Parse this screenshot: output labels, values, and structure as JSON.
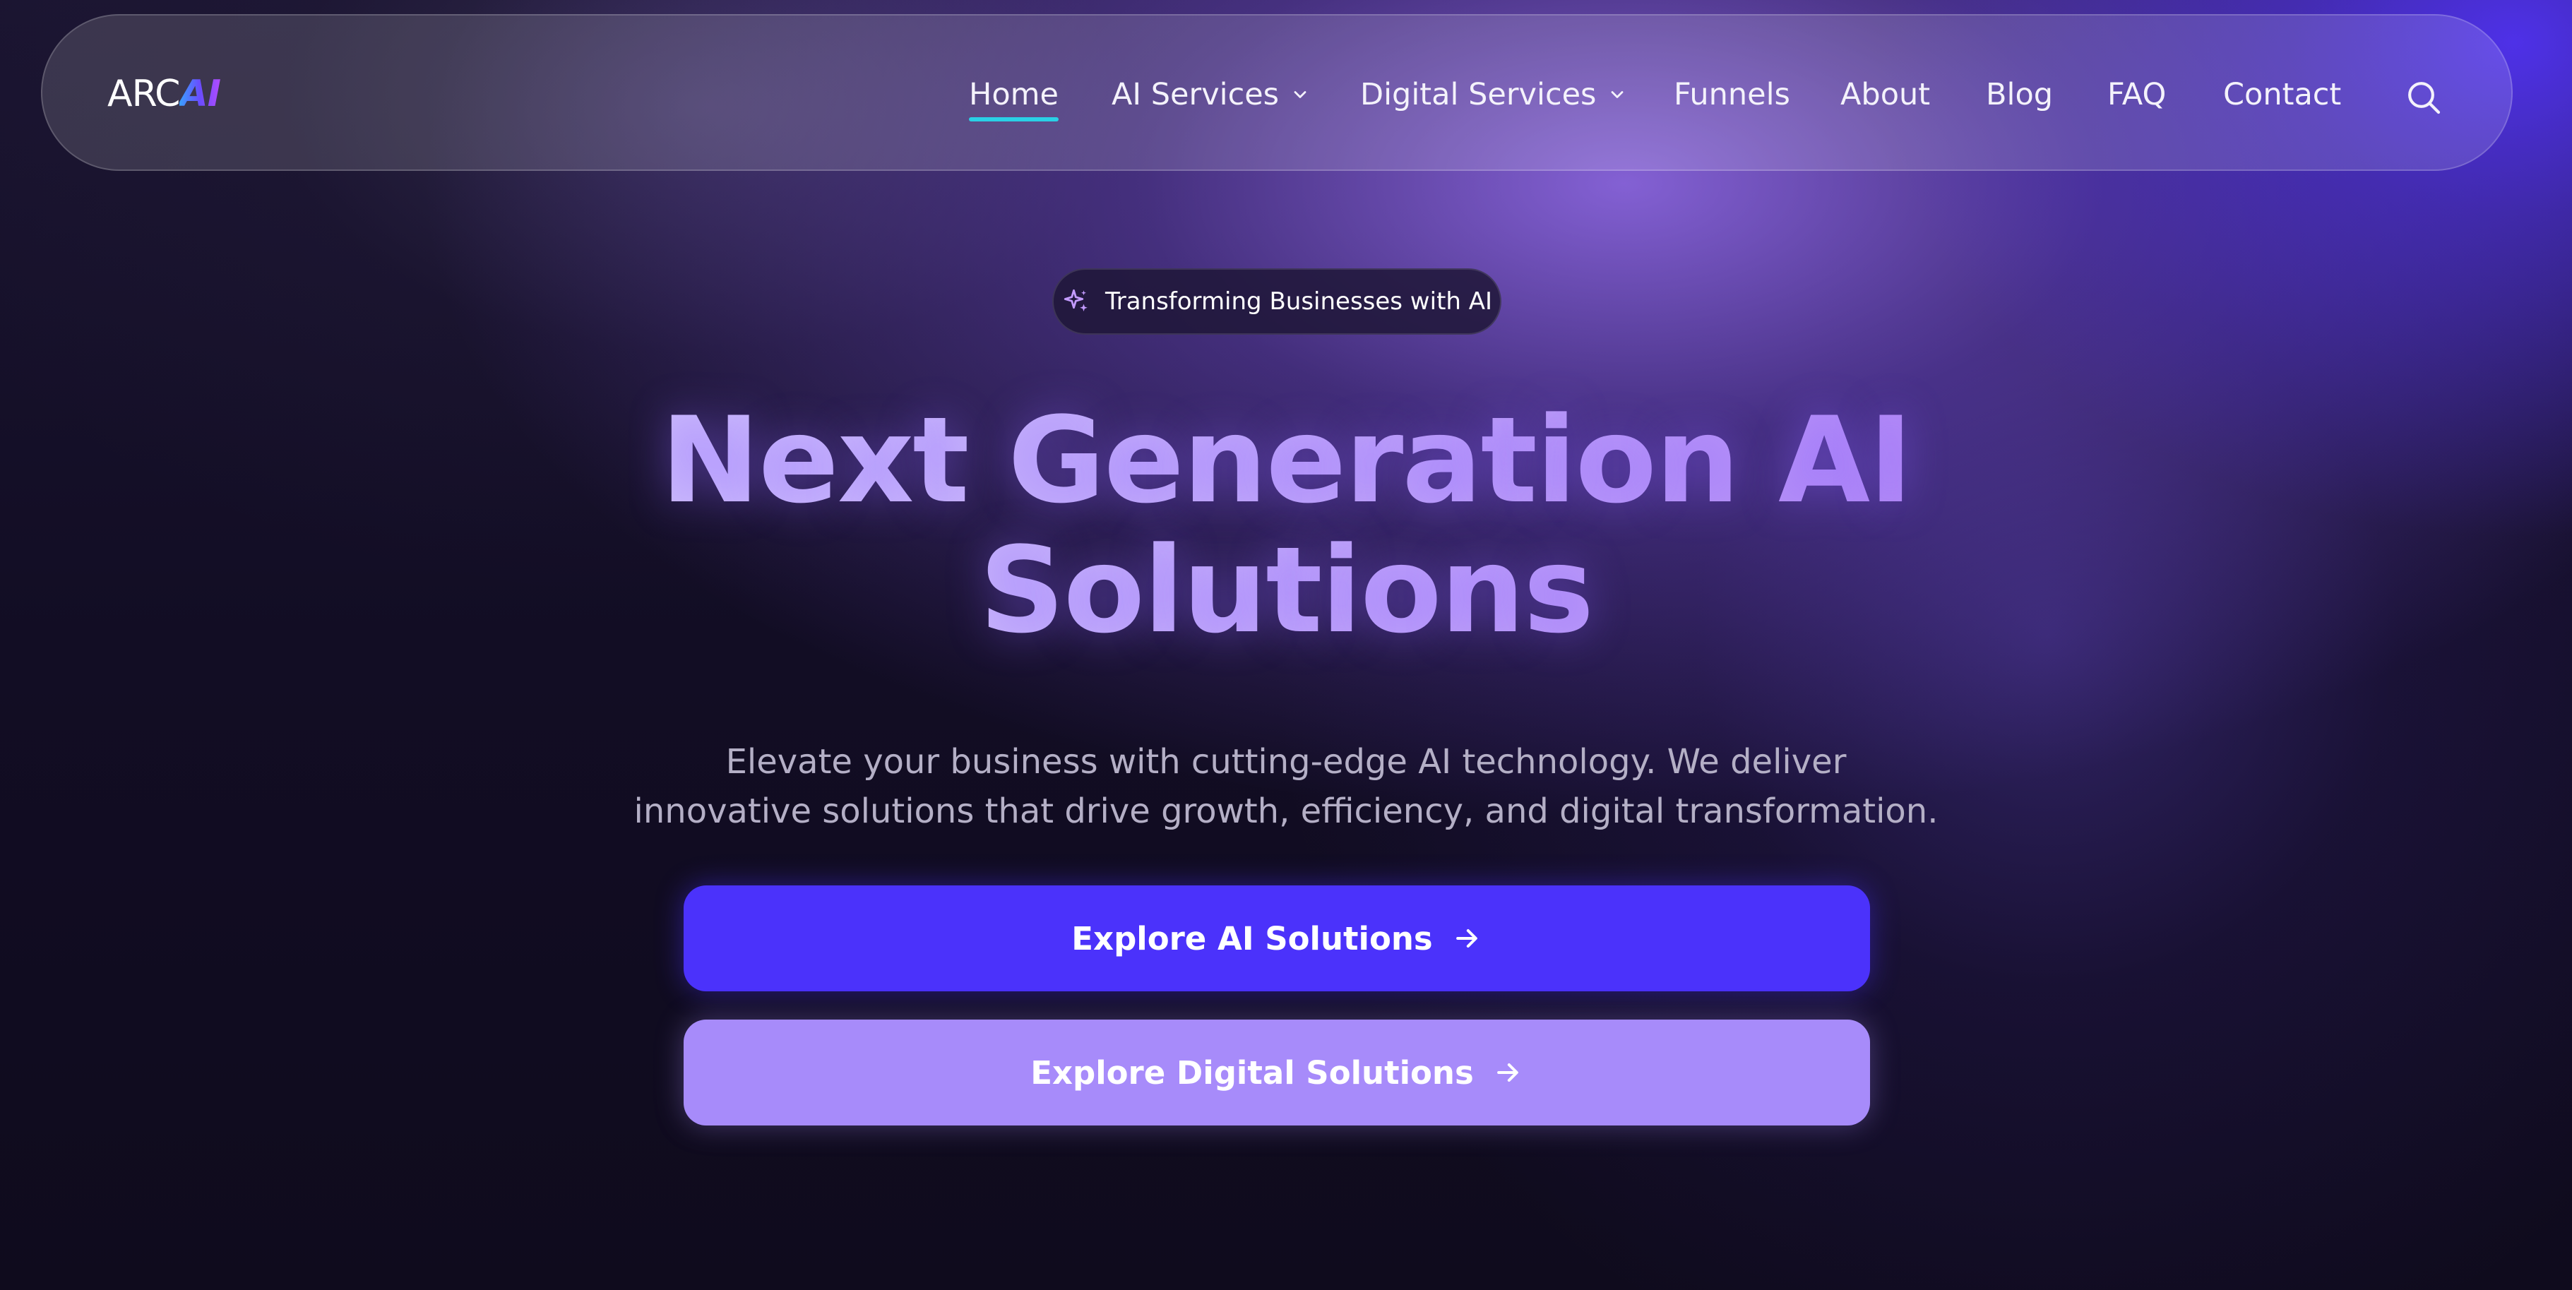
{
  "nav": {
    "logo_arc": "ARC",
    "logo_ai": "AI",
    "links": [
      {
        "label": "Home",
        "active": true
      },
      {
        "label": "AI Services",
        "dropdown": true
      },
      {
        "label": "Digital Services",
        "dropdown": true
      },
      {
        "label": "Funnels"
      },
      {
        "label": "About"
      },
      {
        "label": "Blog"
      },
      {
        "label": "FAQ"
      },
      {
        "label": "Contact"
      }
    ],
    "search_icon": "search-icon"
  },
  "hero": {
    "badge": "Transforming Businesses with AI",
    "badge_icon": "sparkle-icon",
    "title_line1": "Next Generation AI",
    "title_line2": "Solutions",
    "subtitle_line1": "Elevate your business with cutting-edge AI technology. We deliver",
    "subtitle_line2": "innovative solutions that drive growth, efficiency, and digital transformation.",
    "primary_button": "Explore AI Solutions",
    "secondary_button": "Explore Digital Solutions"
  },
  "colors": {
    "primary": "#4b32fb",
    "secondary": "#a78bfa",
    "active_underline": "#2ad0e6",
    "background": "#100c1f"
  }
}
